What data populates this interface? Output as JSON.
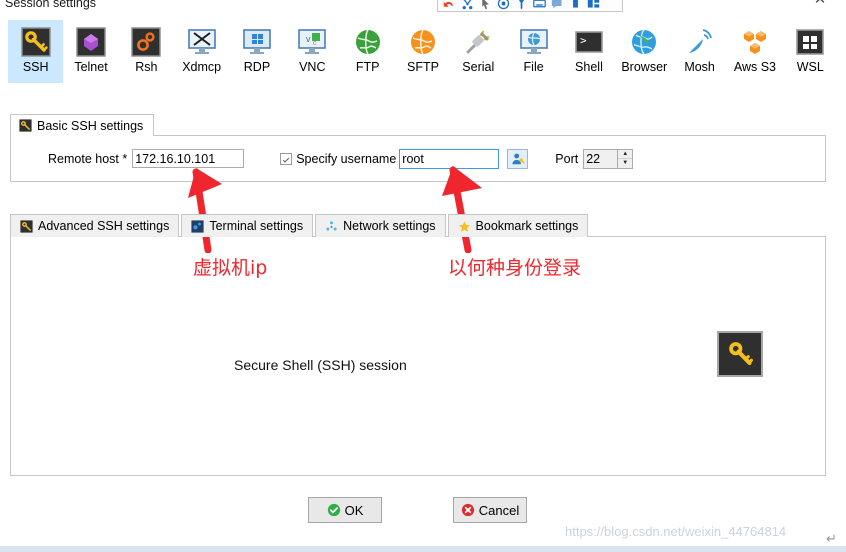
{
  "window": {
    "title": "Session settings",
    "close_label": "✕"
  },
  "protocols": [
    {
      "label": "SSH",
      "icon": "ssh-key-icon",
      "selected": true
    },
    {
      "label": "Telnet",
      "icon": "telnet-icon",
      "selected": false
    },
    {
      "label": "Rsh",
      "icon": "rsh-gears-icon",
      "selected": false
    },
    {
      "label": "Xdmcp",
      "icon": "xdmcp-icon",
      "selected": false
    },
    {
      "label": "RDP",
      "icon": "rdp-monitor-icon",
      "selected": false
    },
    {
      "label": "VNC",
      "icon": "vnc-monitor-icon",
      "selected": false
    },
    {
      "label": "FTP",
      "icon": "ftp-globe-icon",
      "selected": false
    },
    {
      "label": "SFTP",
      "icon": "sftp-globe-icon",
      "selected": false
    },
    {
      "label": "Serial",
      "icon": "serial-plug-icon",
      "selected": false
    },
    {
      "label": "File",
      "icon": "file-monitor-icon",
      "selected": false
    },
    {
      "label": "Shell",
      "icon": "shell-prompt-icon",
      "selected": false
    },
    {
      "label": "Browser",
      "icon": "browser-globe-icon",
      "selected": false
    },
    {
      "label": "Mosh",
      "icon": "mosh-satellite-icon",
      "selected": false
    },
    {
      "label": "Aws S3",
      "icon": "aws-s3-buckets-icon",
      "selected": false
    },
    {
      "label": "WSL",
      "icon": "wsl-windows-icon",
      "selected": false
    }
  ],
  "basic_group": {
    "tab_label": "Basic SSH settings",
    "tab_icon": "ssh-key-icon",
    "remote_host_label": "Remote host *",
    "remote_host_value": "172.16.10.101",
    "remote_host_placeholder": "",
    "specify_username_label": "Specify username",
    "specify_username_checked": true,
    "username_value": "root",
    "username_placeholder": "",
    "username_picker_icon": "user-picker-icon",
    "port_label": "Port",
    "port_value": "22",
    "spin_up": "▲",
    "spin_down": "▼"
  },
  "tabs": [
    {
      "label": "Advanced SSH settings",
      "icon": "ssh-key-icon"
    },
    {
      "label": "Terminal settings",
      "icon": "terminal-icon"
    },
    {
      "label": "Network settings",
      "icon": "network-nodes-icon"
    },
    {
      "label": "Bookmark settings",
      "icon": "star-icon"
    }
  ],
  "panel": {
    "session_text": "Secure Shell (SSH) session",
    "session_icon": "ssh-key-icon"
  },
  "annotations": [
    {
      "id": "ip",
      "text": "虚拟机ip"
    },
    {
      "id": "user",
      "text": "以何种身份登录"
    }
  ],
  "footer": {
    "ok_label": "OK",
    "ok_icon": "green-check-icon",
    "cancel_label": "Cancel",
    "cancel_icon": "red-x-icon"
  },
  "watermark": {
    "text": "https://blog.csdn.net/weixin_44764814",
    "enter_symbol": "↵"
  },
  "colors": {
    "selection_blue": "#cce8ff",
    "annotation_red": "#f0262f",
    "focus_border": "#3d9ae8",
    "key_yellow": "#f5c01e",
    "panel_border": "#c6c6c6"
  }
}
